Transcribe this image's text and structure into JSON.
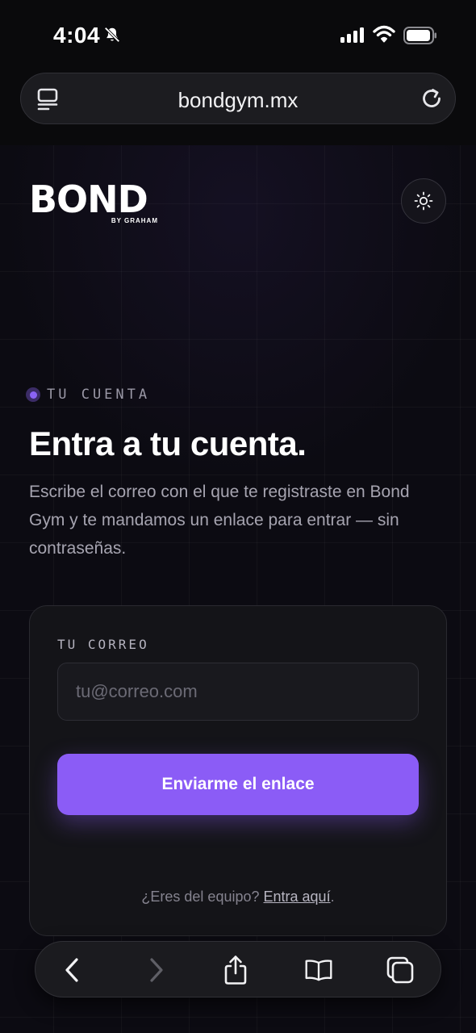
{
  "status_bar": {
    "time": "4:04"
  },
  "browser": {
    "url": "bondgym.mx"
  },
  "brand": {
    "name": "BOND",
    "tagline": "BY GRAHAM"
  },
  "hero": {
    "eyebrow": "TU CUENTA",
    "title": "Entra a tu cuenta.",
    "description": "Escribe el correo con el que te registraste en Bond Gym y te mandamos un enlace para entrar — sin contraseñas."
  },
  "form": {
    "email_label": "TU CORREO",
    "email_placeholder": "tu@correo.com",
    "email_value": "",
    "submit_label": "Enviarme el enlace",
    "team_prompt": "¿Eres del equipo?",
    "team_link": "Entra aquí",
    "team_suffix": "."
  },
  "icons": {
    "status": [
      "bell-muted-icon",
      "signal-icon",
      "wifi-icon",
      "battery-icon"
    ],
    "urlbar": [
      "reader-icon",
      "reload-icon"
    ],
    "page": [
      "sun-icon"
    ],
    "toolbar": [
      "back-icon",
      "forward-icon",
      "share-icon",
      "bookmarks-icon",
      "tabs-icon"
    ]
  },
  "colors": {
    "accent": "#8b5cf6",
    "background": "#0c0b12",
    "card": "#141418"
  }
}
